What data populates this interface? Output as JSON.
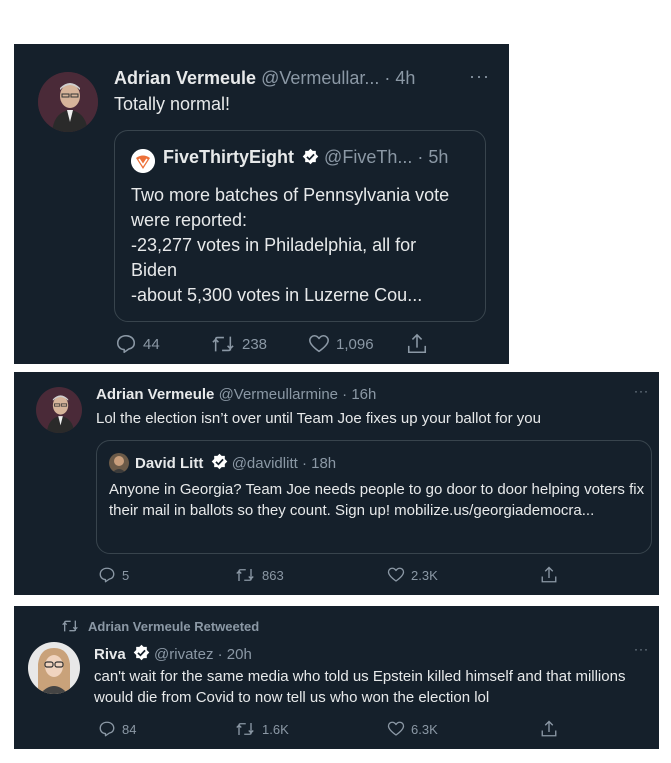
{
  "tweet1": {
    "author": "Adrian Vermeule",
    "handle": "@Vermeullar...",
    "time": "· 4h",
    "more": "···",
    "text": "Totally normal!",
    "quote": {
      "author": "FiveThirtyEight",
      "handle": "@FiveTh...",
      "time": "· 5h",
      "text": "Two more batches of Pennsylvania vote were reported:\n-23,277 votes in Philadelphia, all for Biden\n-about 5,300 votes in Luzerne Cou..."
    },
    "replies": "44",
    "retweets": "238",
    "likes": "1,096"
  },
  "tweet2": {
    "author": "Adrian Vermeule",
    "handle": "@Vermeullarmine",
    "time": "· 16h",
    "more": "···",
    "text": "Lol the election isn’t over until Team Joe fixes up your ballot for you",
    "quote": {
      "author": "David Litt",
      "handle": "@davidlitt",
      "time": "· 18h",
      "text": "Anyone in Georgia? Team Joe needs people to go door to door helping voters fix their mail in ballots so they count. Sign up! mobilize.us/georgiademocra..."
    },
    "replies": "5",
    "retweets": "863",
    "likes": "2.3K"
  },
  "tweet3": {
    "retweeted_by": "Adrian Vermeule Retweeted",
    "author": "Riva",
    "handle": "@rivatez",
    "time": "· 20h",
    "more": "···",
    "text": "can't wait for the same media who told us Epstein killed himself and that millions would die from Covid to now tell us who won the election lol",
    "replies": "84",
    "retweets": "1.6K",
    "likes": "6.3K"
  },
  "colors": {
    "background": "#15202b",
    "text": "#e7e9ea",
    "muted": "#8b98a5",
    "verified": "#1d9bf0",
    "border": "#38444d"
  },
  "icons": [
    "reply-icon",
    "retweet-icon",
    "like-icon",
    "share-icon",
    "verified-badge-icon",
    "more-icon"
  ]
}
